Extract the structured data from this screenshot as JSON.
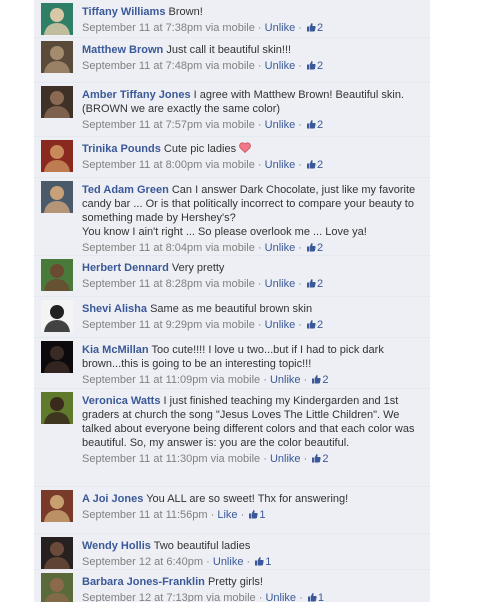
{
  "separator": "·",
  "comments": [
    {
      "author": "Tiffany Williams",
      "text": "Brown!",
      "time": "September 11 at 7:38pm via mobile",
      "action": "Unlike",
      "likes": "2",
      "heart": false
    },
    {
      "author": "Matthew Brown",
      "text": "Just call it beautiful skin!!!",
      "time": "September 11 at 7:48pm via mobile",
      "action": "Unlike",
      "likes": "2",
      "heart": false
    },
    {
      "author": "Amber Tiffany Jones",
      "text": "I agree with Matthew Brown! Beautiful skin. (BROWN we are exactly the same color)",
      "time": "September 11 at 7:57pm via mobile",
      "action": "Unlike",
      "likes": "2",
      "heart": false
    },
    {
      "author": "Trinika Pounds",
      "text": "Cute pic ladies",
      "time": "September 11 at 8:00pm via mobile",
      "action": "Unlike",
      "likes": "2",
      "heart": true
    },
    {
      "author": "Ted Adam Green",
      "text": "Can I answer Dark Chocolate, just like my favorite candy bar ... Or is that politically incorrect to compare your beauty to something made by Hershey's?\nYou know I ain't right ... So please overlook me ... Love ya!",
      "time": "September 11 at 8:04pm via mobile",
      "action": "Unlike",
      "likes": "2",
      "heart": false
    },
    {
      "author": "Herbert Dennard",
      "text": "Very pretty",
      "time": "September 11 at 8:28pm via mobile",
      "action": "Unlike",
      "likes": "2",
      "heart": false
    },
    {
      "author": "Shevi Alisha",
      "text": "Same as me beautiful brown skin",
      "time": "September 11 at 9:29pm via mobile",
      "action": "Unlike",
      "likes": "2",
      "heart": false
    },
    {
      "author": "Kia McMillan",
      "text": "Too cute!!!! I love u two...but if I had to pick dark brown...this is going to be an interesting topic!!!",
      "time": "September 11 at 11:09pm via mobile",
      "action": "Unlike",
      "likes": "2",
      "heart": false
    },
    {
      "author": "Veronica Watts",
      "text": "I just finished teaching my Kindergarden and 1st graders at church the song \"Jesus Loves The Little Children\". We talked about everyone being different colors and that each color was beautiful. So, my answer is: you are the color beautiful.",
      "time": "September 11 at 11:30pm via mobile",
      "action": "Unlike",
      "likes": "2",
      "heart": false
    },
    {
      "author": "A Joi Jones",
      "text": "You ALL are so sweet! Thx for answering!",
      "time": "September 11 at 11:56pm",
      "action": "Like",
      "likes": "1",
      "heart": false
    },
    {
      "author": "Wendy Hollis",
      "text": "Two beautiful ladies",
      "time": "September 12 at 6:40pm",
      "action": "Unlike",
      "likes": "1",
      "heart": false
    },
    {
      "author": "Barbara Jones-Franklin",
      "text": "Pretty girls!",
      "time": "September 12 at 7:13pm via mobile",
      "action": "Unlike",
      "likes": "1",
      "heart": false
    }
  ]
}
